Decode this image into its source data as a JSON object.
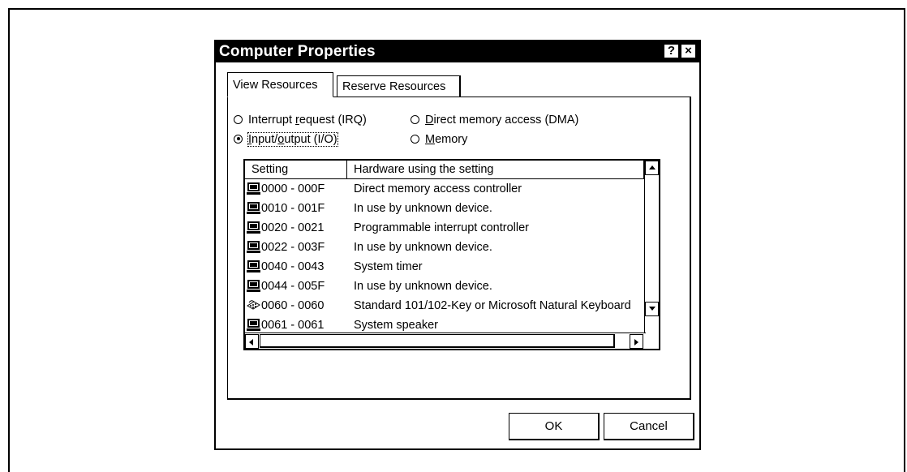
{
  "dialog": {
    "title": "Computer Properties",
    "help_label": "?",
    "close_label": "×"
  },
  "tabs": [
    {
      "label": "View Resources",
      "selected": true
    },
    {
      "label": "Reserve Resources",
      "selected": false
    }
  ],
  "radios": {
    "irq": {
      "pre": "Interrupt ",
      "accel": "r",
      "post": "equest (IRQ)",
      "checked": false
    },
    "dma": {
      "pre": "",
      "accel": "D",
      "post": "irect memory access (DMA)",
      "checked": false
    },
    "io": {
      "pre": "",
      "accel": "I",
      "post": "nput/",
      "accel2": "o",
      "post2": "utput (I/O)",
      "checked": true
    },
    "memory": {
      "pre": "",
      "accel": "M",
      "post": "emory",
      "checked": false
    }
  },
  "list": {
    "columns": [
      "Setting",
      "Hardware using the setting"
    ],
    "rows": [
      {
        "setting": "0000 - 000F",
        "hardware": "Direct memory access controller",
        "icon": "computer-icon"
      },
      {
        "setting": "0010 - 001F",
        "hardware": "In use by unknown device.",
        "icon": "computer-icon"
      },
      {
        "setting": "0020 - 0021",
        "hardware": "Programmable interrupt controller",
        "icon": "computer-icon"
      },
      {
        "setting": "0022 - 003F",
        "hardware": "In use by unknown device.",
        "icon": "computer-icon"
      },
      {
        "setting": "0040 - 0043",
        "hardware": "System timer",
        "icon": "computer-icon"
      },
      {
        "setting": "0044 - 005F",
        "hardware": "In use by unknown device.",
        "icon": "computer-icon"
      },
      {
        "setting": "0060 - 0060",
        "hardware": "Standard 101/102-Key or Microsoft Natural Keyboard",
        "icon": "keyboard-icon"
      },
      {
        "setting": "0061 - 0061",
        "hardware": "System speaker",
        "icon": "computer-icon"
      }
    ]
  },
  "buttons": {
    "ok": "OK",
    "cancel": "Cancel"
  }
}
